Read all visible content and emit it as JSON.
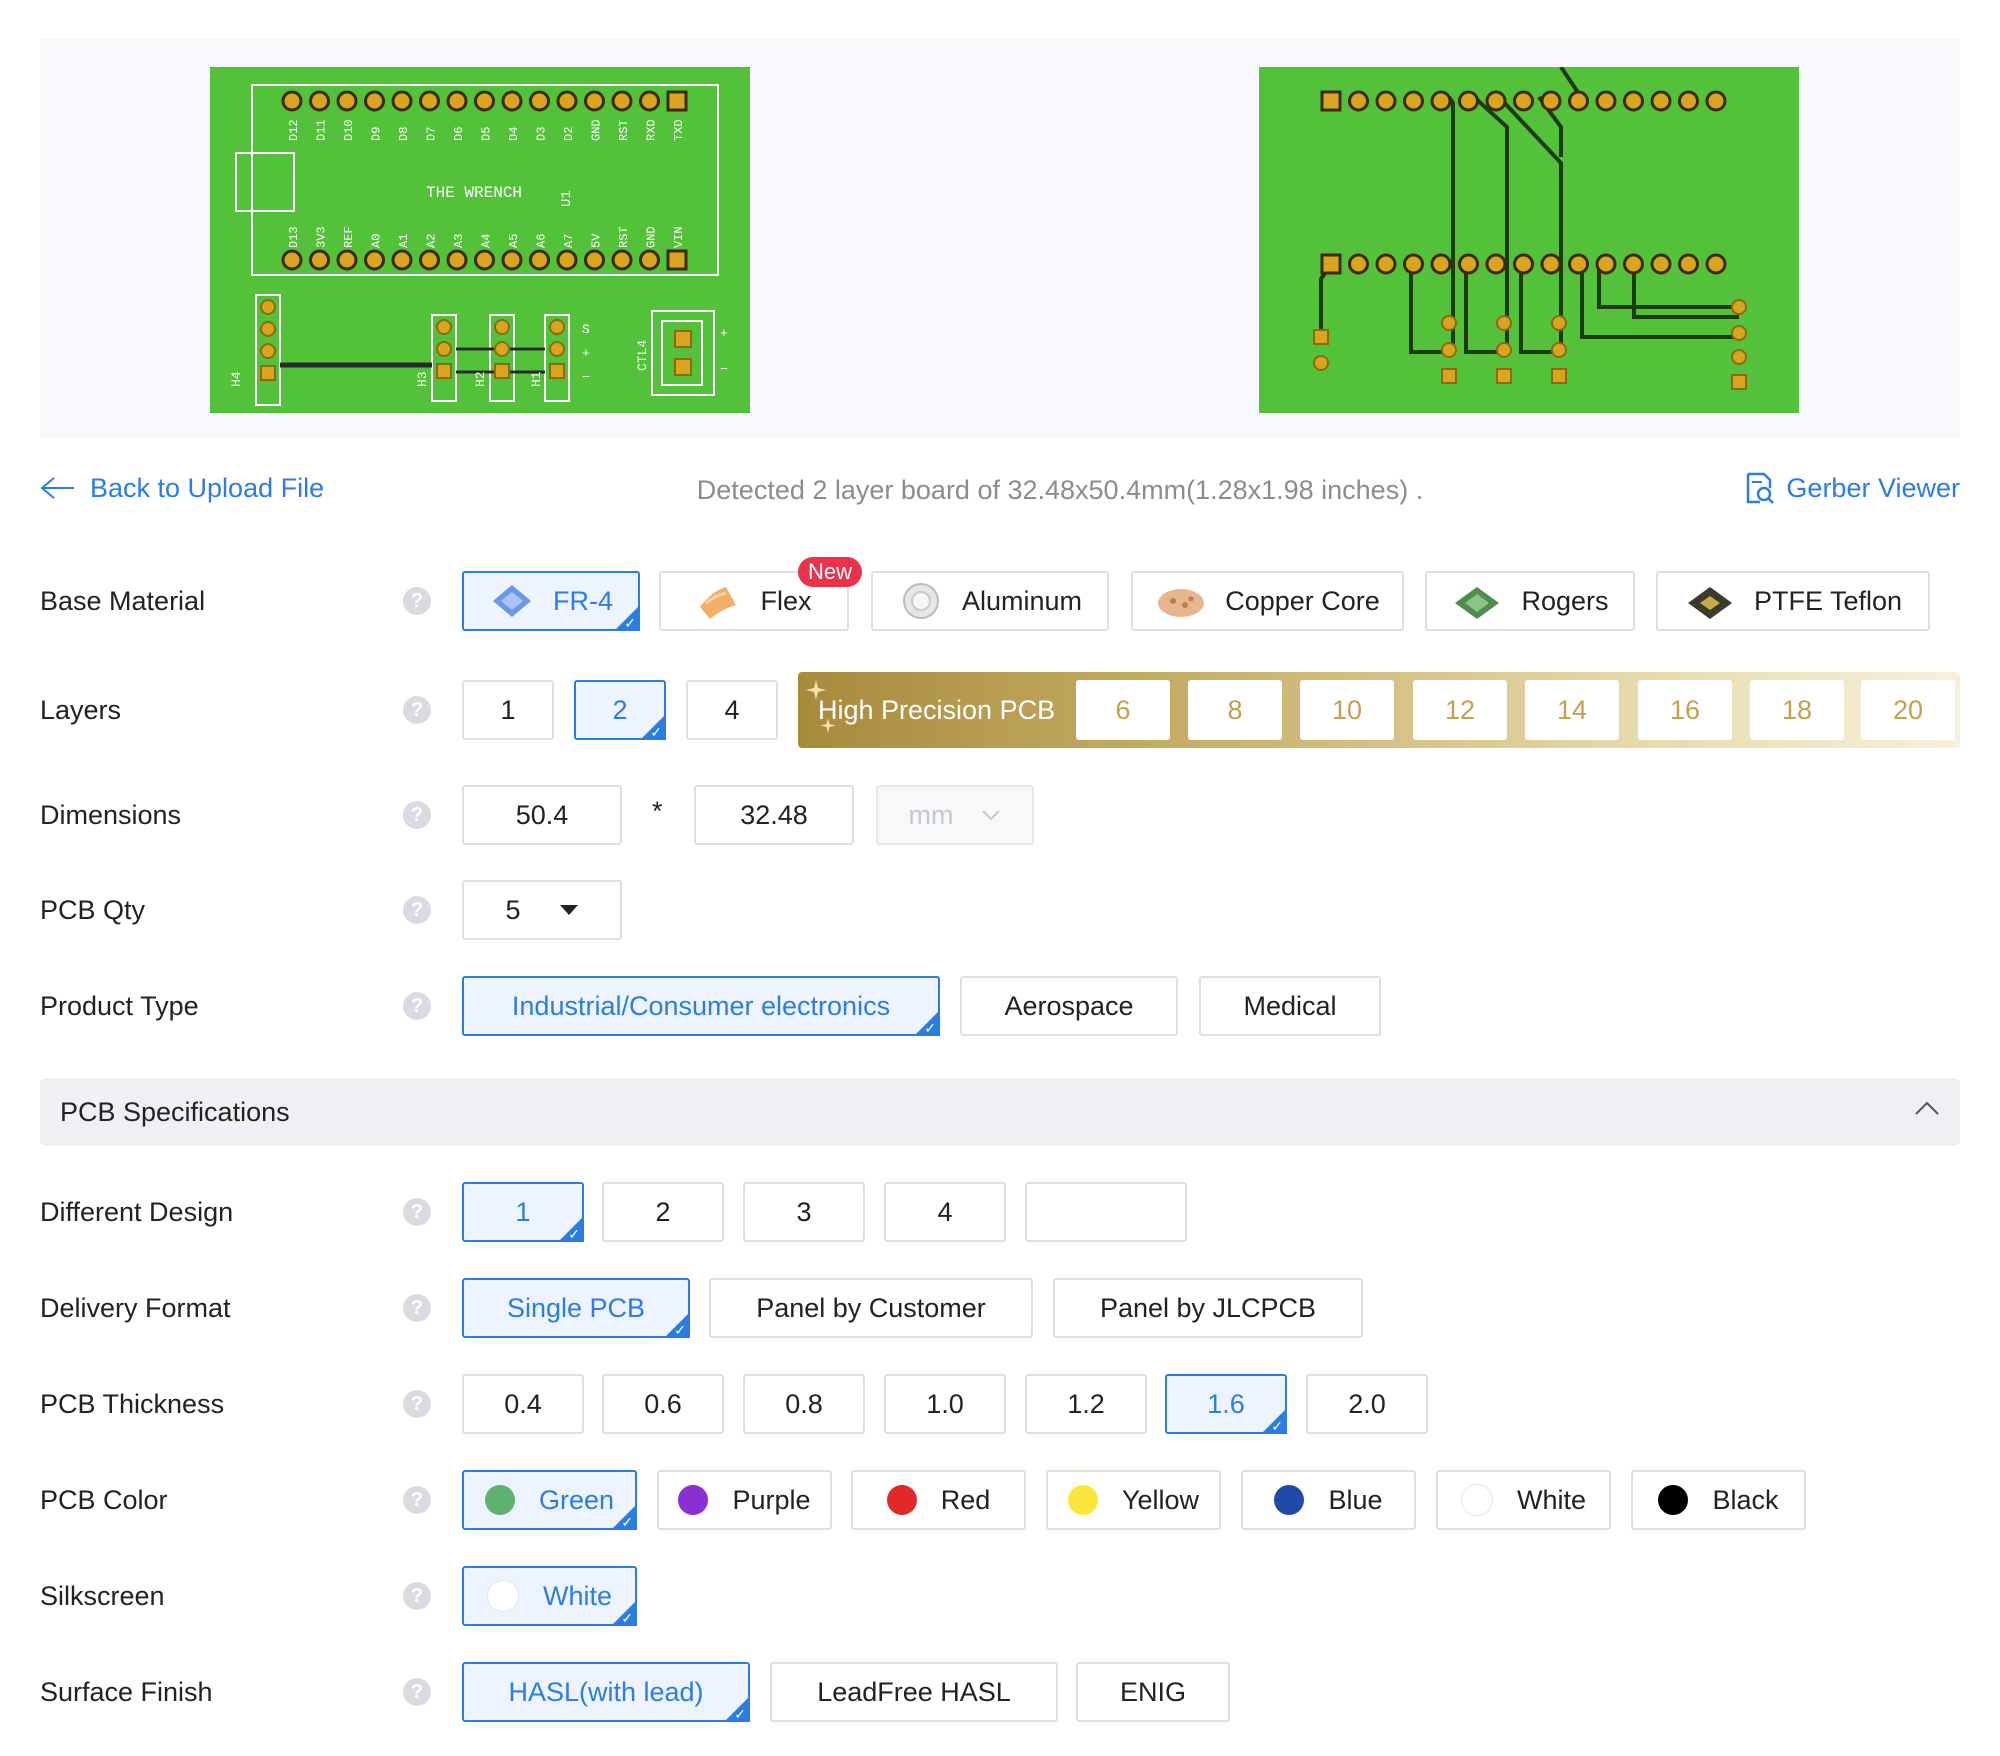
{
  "header": {
    "back_label": "Back to Upload File",
    "detected_text": "Detected 2 layer board of 32.48x50.4mm(1.28x1.98 inches) .",
    "gerber_label": "Gerber Viewer"
  },
  "board_top": {
    "title": "THE WRENCH",
    "u1": "U1",
    "top_pins": [
      "D12",
      "D11",
      "D10",
      "D9",
      "D8",
      "D7",
      "D6",
      "D5",
      "D4",
      "D3",
      "D2",
      "GND",
      "RST",
      "RXD",
      "TXD"
    ],
    "bottom_pins": [
      "D13",
      "3V3",
      "REF",
      "A0",
      "A1",
      "A2",
      "A3",
      "A4",
      "A5",
      "A6",
      "A7",
      "5V",
      "RST",
      "GND",
      "VIN"
    ],
    "headers": [
      "H4",
      "H3",
      "H2",
      "H1",
      "CTL4"
    ],
    "marks": [
      "S",
      "+",
      "−",
      "+",
      "−"
    ]
  },
  "labels": {
    "base_material": "Base Material",
    "layers": "Layers",
    "dimensions": "Dimensions",
    "pcb_qty": "PCB Qty",
    "product_type": "Product Type",
    "different_design": "Different Design",
    "delivery_format": "Delivery Format",
    "pcb_thickness": "PCB Thickness",
    "pcb_color": "PCB Color",
    "silkscreen": "Silkscreen",
    "surface_finish": "Surface Finish",
    "help": "?"
  },
  "base_material": {
    "options": [
      "FR-4",
      "Flex",
      "Aluminum",
      "Copper Core",
      "Rogers",
      "PTFE Teflon"
    ],
    "selected": "FR-4",
    "new_badge": "New"
  },
  "layers": {
    "options": [
      "1",
      "2",
      "4"
    ],
    "selected": "2",
    "high_precision_label": "High Precision PCB",
    "high_precision_options": [
      "6",
      "8",
      "10",
      "12",
      "14",
      "16",
      "18",
      "20"
    ]
  },
  "dimensions": {
    "length": "50.4",
    "sep": "*",
    "width": "32.48",
    "unit": "mm"
  },
  "pcb_qty": {
    "value": "5"
  },
  "product_type": {
    "options": [
      "Industrial/Consumer electronics",
      "Aerospace",
      "Medical"
    ],
    "selected": "Industrial/Consumer electronics"
  },
  "section": {
    "title": "PCB Specifications"
  },
  "different_design": {
    "options": [
      "1",
      "2",
      "3",
      "4"
    ],
    "selected": "1",
    "custom": ""
  },
  "delivery_format": {
    "options": [
      "Single PCB",
      "Panel by Customer",
      "Panel by JLCPCB"
    ],
    "selected": "Single PCB"
  },
  "pcb_thickness": {
    "options": [
      "0.4",
      "0.6",
      "0.8",
      "1.0",
      "1.2",
      "1.6",
      "2.0"
    ],
    "selected": "1.6"
  },
  "pcb_color": {
    "options": [
      {
        "label": "Green",
        "color": "#5fb26e"
      },
      {
        "label": "Purple",
        "color": "#8a2fd1"
      },
      {
        "label": "Red",
        "color": "#e02a2a"
      },
      {
        "label": "Yellow",
        "color": "#f8e63a"
      },
      {
        "label": "Blue",
        "color": "#1f4aa8"
      },
      {
        "label": "White",
        "color": "#ffffff"
      },
      {
        "label": "Black",
        "color": "#000000"
      }
    ],
    "selected": "Green"
  },
  "silkscreen": {
    "options": [
      {
        "label": "White",
        "color": "#ffffff"
      }
    ],
    "selected": "White"
  },
  "surface_finish": {
    "options": [
      "HASL(with lead)",
      "LeadFree HASL",
      "ENIG"
    ],
    "selected": "HASL(with lead)"
  }
}
